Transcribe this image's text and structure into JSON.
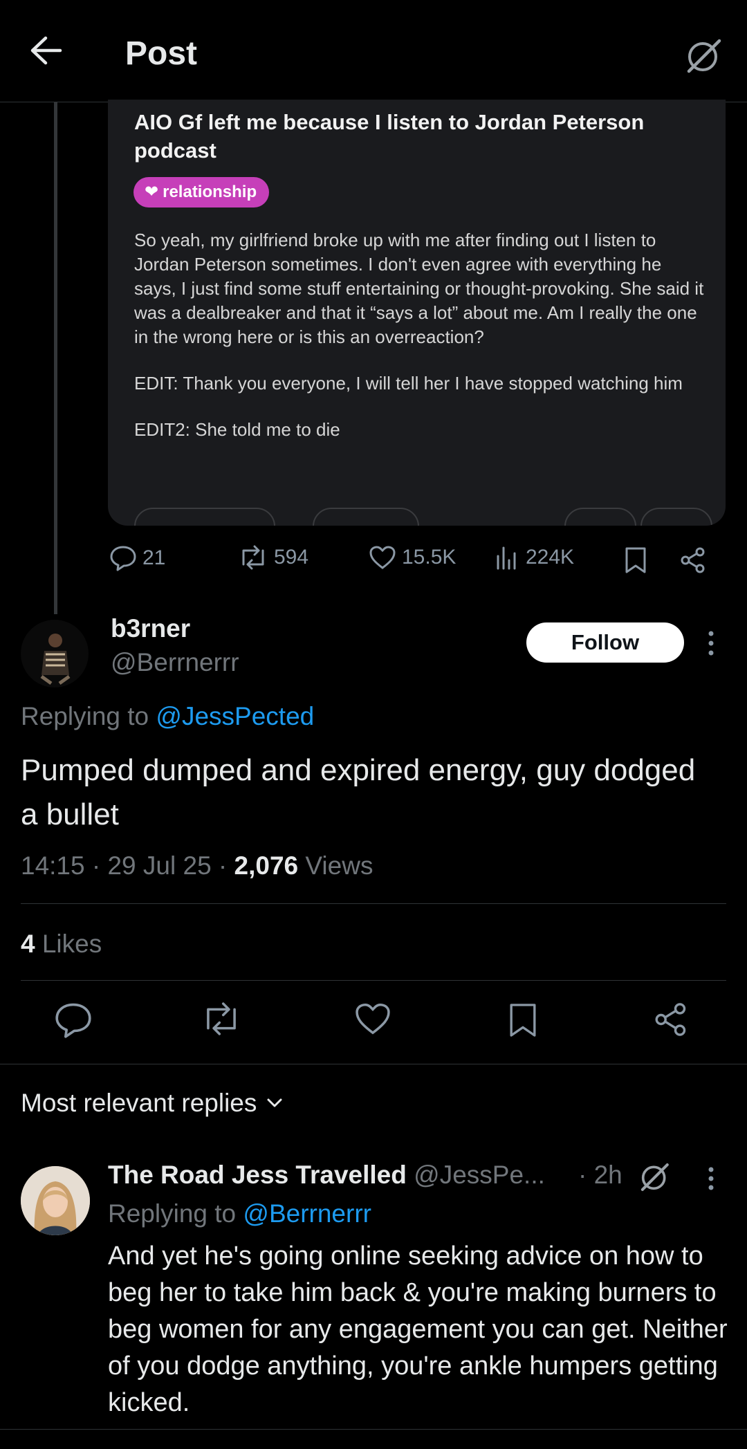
{
  "header": {
    "title": "Post"
  },
  "embed": {
    "title": "AIO Gf left me because I listen to Jordan Peterson podcast",
    "flair": "relationship",
    "body": "So yeah, my girlfriend broke up with me after finding out I listen to Jordan Peterson sometimes. I don't even agree with everything he says, I just find some stuff entertaining or thought-provoking. She said it was a dealbreaker and that it “says a lot” about me. Am I really the one in the wrong here or is this an overreaction?",
    "edit1": "EDIT: Thank you everyone, I will tell her I have stopped watching him",
    "edit2": "EDIT2: She told me to die"
  },
  "quoted_stats": {
    "replies": "21",
    "reposts": "594",
    "likes": "15.5K",
    "views": "224K"
  },
  "post": {
    "display_name": "b3rner",
    "handle": "@Berrnerrr",
    "follow_label": "Follow",
    "replying_prefix": "Replying to",
    "replying_to": "@JessPected",
    "text": "Pumped dumped and expired energy, guy dodged a bullet",
    "time": "14:15",
    "date": "29 Jul 25",
    "views_count": "2,076",
    "views_label": "Views",
    "likes_count": "4",
    "likes_label": "Likes"
  },
  "replies_section": {
    "sort_label": "Most relevant replies"
  },
  "reply": {
    "display_name": "The Road Jess Travelled",
    "handle": "@JessPe...",
    "age": "· 2h",
    "replying_prefix": "Replying to",
    "replying_to": "@Berrnerrr",
    "text": "And yet he's going online seeking advice on how to beg her to take him back & you're making burners to beg women for any engagement you can get. Neither of you dodge anything, you're ankle humpers getting kicked."
  },
  "icons": [
    "back-arrow-icon",
    "grok-icon",
    "comment-icon",
    "repost-icon",
    "like-icon",
    "views-icon",
    "bookmark-icon",
    "share-icon",
    "more-icon",
    "chevron-down-icon"
  ]
}
